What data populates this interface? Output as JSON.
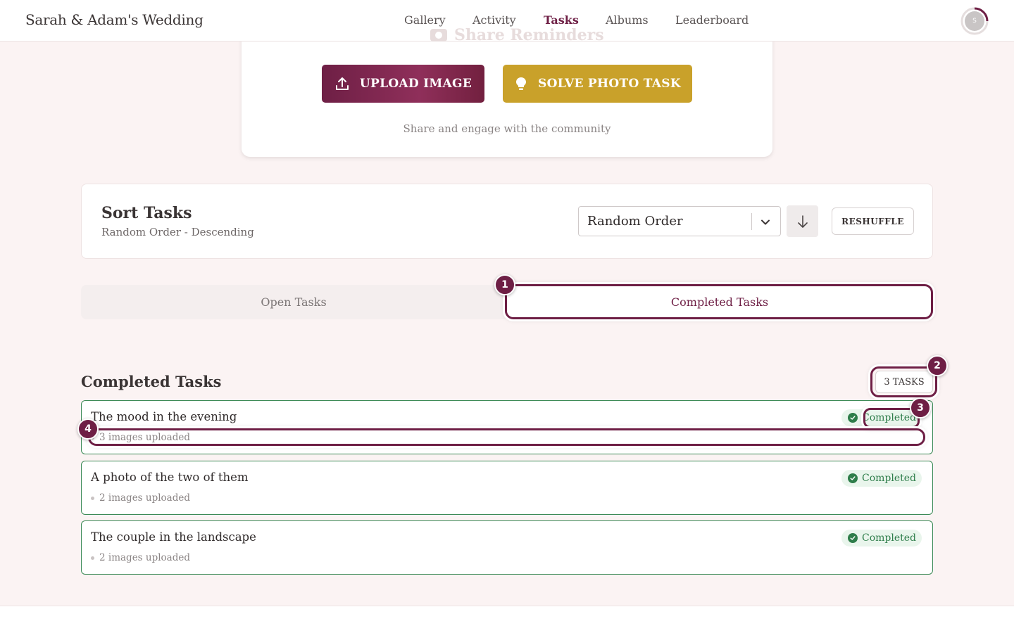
{
  "header": {
    "brand": "Sarah & Adam's Wedding",
    "nav": [
      "Gallery",
      "Activity",
      "Tasks",
      "Albums",
      "Leaderboard"
    ],
    "active_nav": "Tasks",
    "avatar_initial": "S",
    "ghost_title": "Share Reminders"
  },
  "upload": {
    "upload_label": "UPLOAD IMAGE",
    "solve_label": "SOLVE PHOTO TASK",
    "tagline": "Share and engage with the community"
  },
  "sort": {
    "title": "Sort Tasks",
    "subtitle": "Random Order - Descending",
    "selected": "Random Order",
    "reshuffle_label": "RESHUFFLE"
  },
  "tabs": {
    "open_label": "Open Tasks",
    "completed_label": "Completed Tasks",
    "active": "Completed Tasks"
  },
  "completed": {
    "heading": "Completed Tasks",
    "count_label": "3 TASKS",
    "tasks": [
      {
        "title": "The mood in the evening",
        "meta": "3 images uploaded",
        "status": "Completed"
      },
      {
        "title": "A photo of the two of them",
        "meta": "2 images uploaded",
        "status": "Completed"
      },
      {
        "title": "The couple in the landscape",
        "meta": "2 images uploaded",
        "status": "Completed"
      }
    ]
  },
  "annotations": [
    "1",
    "2",
    "3",
    "4"
  ],
  "colors": {
    "brand": "#6e1f45",
    "gold": "#c9a12a",
    "success": "#2e7d4a",
    "background": "#fbf3f3"
  },
  "icons": {
    "upload": "upload-icon",
    "solve": "lightbulb-icon",
    "dropdown": "chevron-down-icon",
    "direction": "arrow-down-icon",
    "status": "check-circle-icon"
  }
}
